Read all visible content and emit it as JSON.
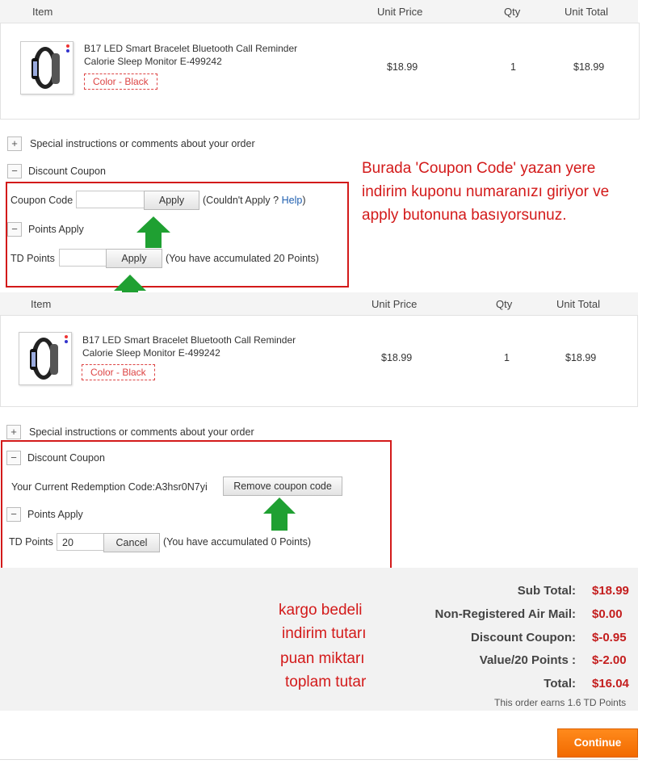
{
  "cart_top": {
    "headers": {
      "item": "Item",
      "unit_price": "Unit Price",
      "qty": "Qty",
      "unit_total": "Unit Total"
    },
    "product": {
      "name_line1": "B17 LED Smart Bracelet Bluetooth Call Reminder",
      "name_line2": "Calorie Sleep Monitor E-499242",
      "color": "Color - Black",
      "unit_price": "$18.99",
      "qty": "1",
      "unit_total": "$18.99"
    },
    "special_instructions": "Special instructions or comments about your order",
    "discount_coupon": "Discount Coupon",
    "coupon_code_label": "Coupon Code",
    "coupon_code_value": "",
    "apply_label": "Apply",
    "couldnt_apply_prefix": "(Couldn't Apply ?",
    "help_link": "Help",
    "couldnt_apply_suffix": ")",
    "points_apply": "Points Apply",
    "td_points_label": "TD Points",
    "td_points_value": "",
    "points_apply_button": "Apply",
    "accumulated_note": "(You have accumulated 20 Points)"
  },
  "annotation_top": {
    "line1": "Burada 'Coupon Code' yazan yere",
    "line2": "indirim kuponu numaranızı giriyor ve",
    "line3": "apply butonuna basıyorsunuz."
  },
  "cart_bottom": {
    "headers": {
      "item": "Item",
      "unit_price": "Unit Price",
      "qty": "Qty",
      "unit_total": "Unit Total"
    },
    "product": {
      "name_line1": "B17 LED Smart Bracelet Bluetooth Call Reminder",
      "name_line2": "Calorie Sleep Monitor E-499242",
      "color": "Color - Black",
      "unit_price": "$18.99",
      "qty": "1",
      "unit_total": "$18.99"
    },
    "special_instructions": "Special instructions or comments about your order",
    "discount_coupon": "Discount Coupon",
    "redemption_label": "Your Current Redemption Code:A3hsr0N7yi",
    "remove_coupon_button": "Remove coupon code",
    "points_apply": "Points Apply",
    "td_points_label": "TD Points",
    "td_points_value": "20",
    "cancel_button": "Cancel",
    "accumulated_note": "(You have accumulated 0 Points)"
  },
  "annotation_bottom": {
    "line1": "kargo bedeli",
    "line2": "indirim tutarı",
    "line3": "puan miktarı",
    "line4": "toplam tutar"
  },
  "summary": {
    "subtotal_label": "Sub Total:",
    "subtotal_value": "$18.99",
    "shipping_label": "Non-Registered Air Mail:",
    "shipping_value": "$0.00",
    "discount_label": "Discount Coupon:",
    "discount_value": "$-0.95",
    "points_label": "Value/20 Points :",
    "points_value": "$-2.00",
    "total_label": "Total:",
    "total_value": "$16.04",
    "earns_note": "This order earns 1.6 TD Points"
  },
  "continue_button": "Continue",
  "colors": {
    "annotation_red": "#d31a1a",
    "price_red": "#c41e1e",
    "arrow_green": "#1fa032",
    "continue_orange": "#f57800"
  }
}
